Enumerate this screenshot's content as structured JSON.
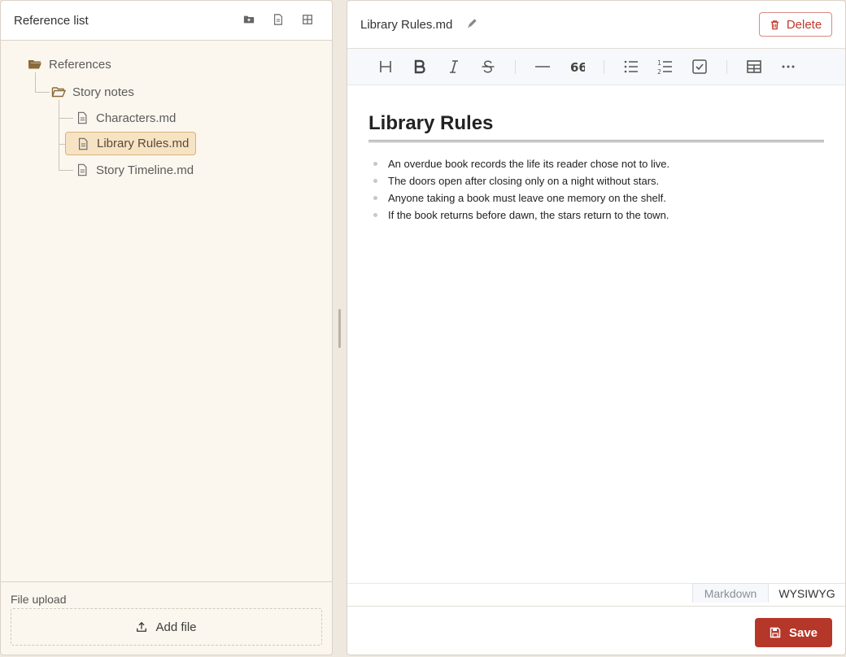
{
  "left_panel": {
    "title": "Reference list",
    "header_icons": [
      "new-folder-icon",
      "new-file-icon",
      "grid-icon"
    ],
    "tree": {
      "root": {
        "label": "References",
        "icon": "folder-open-icon"
      },
      "folder": {
        "label": "Story notes",
        "icon": "folder-open-icon"
      },
      "files": [
        {
          "label": "Characters.md",
          "icon": "file-icon",
          "selected": false
        },
        {
          "label": "Library Rules.md",
          "icon": "file-icon",
          "selected": true
        },
        {
          "label": "Story Timeline.md",
          "icon": "file-icon",
          "selected": false
        }
      ]
    },
    "upload": {
      "label": "File upload",
      "button_label": "Add file"
    }
  },
  "document": {
    "filename": "Library Rules.md",
    "delete_label": "Delete",
    "toolbar_icons": [
      "heading-icon",
      "bold-icon",
      "italic-icon",
      "strikethrough-icon",
      "horizontal-rule-icon",
      "quote-icon",
      "bullet-list-icon",
      "ordered-list-icon",
      "task-list-icon",
      "table-icon",
      "more-icon"
    ],
    "content": {
      "heading": "Library Rules",
      "bullets": [
        "An overdue book records the life its reader chose not to live.",
        "The doors open after closing only on a night without stars.",
        "Anyone taking a book must leave one memory on the shelf.",
        "If the book returns before dawn, the stars return to the town."
      ]
    },
    "mode_tabs": [
      {
        "label": "Markdown",
        "active": false
      },
      {
        "label": "WYSIWYG",
        "active": true
      }
    ],
    "save_label": "Save"
  },
  "colors": {
    "accent": "#b5372a",
    "selected_bg": "#f6e3c4",
    "folder": "#8a6a3a",
    "panel_bg": "#fcf7ee"
  }
}
